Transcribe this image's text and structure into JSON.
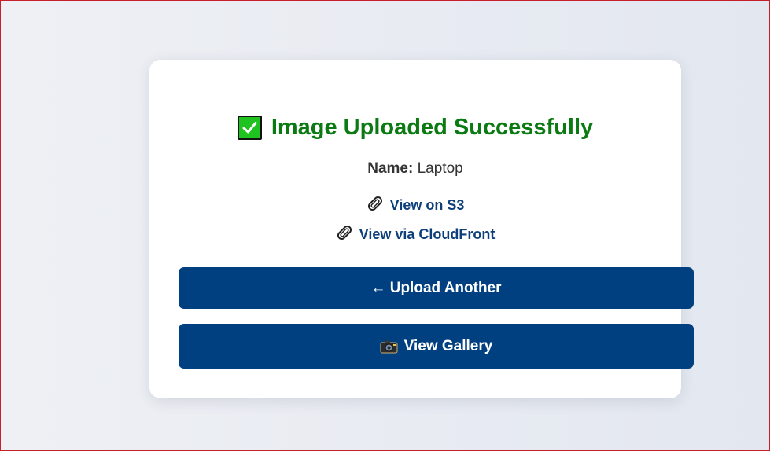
{
  "card": {
    "title": "Image Uploaded Successfully",
    "name_label": "Name:",
    "name_value": "Laptop",
    "links": {
      "s3": "View on S3",
      "cloudfront": "View via CloudFront"
    },
    "buttons": {
      "upload_another": "← Upload Another",
      "view_gallery": "View Gallery"
    }
  },
  "icons": {
    "title": "check-mark-icon",
    "links": "paperclip-icon",
    "gallery": "camera-icon"
  },
  "colors": {
    "title": "#0b7a12",
    "link": "#0d3f7a",
    "button": "#003f80",
    "check_box": "#1fc21f"
  }
}
